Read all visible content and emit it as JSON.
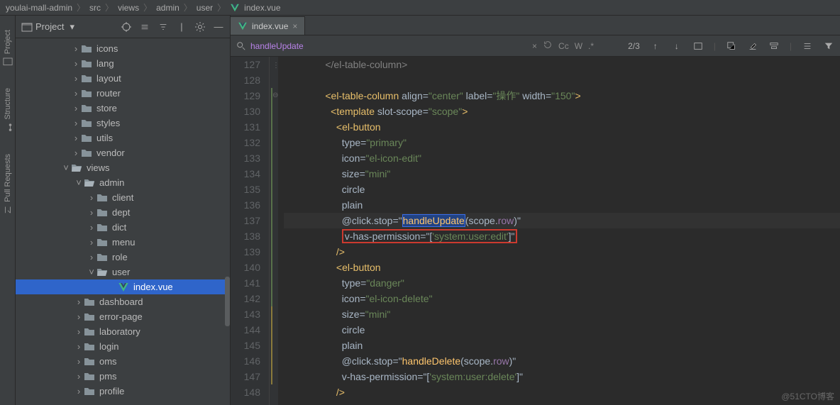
{
  "breadcrumb": [
    "youlai-mall-admin",
    "src",
    "views",
    "admin",
    "user",
    "index.vue"
  ],
  "sidebar": {
    "title": "Project",
    "items": [
      {
        "label": "icons",
        "indent": 78,
        "arrow": ">",
        "kind": "folder"
      },
      {
        "label": "lang",
        "indent": 78,
        "arrow": ">",
        "kind": "folder"
      },
      {
        "label": "layout",
        "indent": 78,
        "arrow": ">",
        "kind": "folder"
      },
      {
        "label": "router",
        "indent": 78,
        "arrow": ">",
        "kind": "folder"
      },
      {
        "label": "store",
        "indent": 78,
        "arrow": ">",
        "kind": "folder"
      },
      {
        "label": "styles",
        "indent": 78,
        "arrow": ">",
        "kind": "folder"
      },
      {
        "label": "utils",
        "indent": 78,
        "arrow": ">",
        "kind": "folder"
      },
      {
        "label": "vendor",
        "indent": 78,
        "arrow": ">",
        "kind": "folder"
      },
      {
        "label": "views",
        "indent": 64,
        "arrow": "v",
        "kind": "folder-open"
      },
      {
        "label": "admin",
        "indent": 82,
        "arrow": "v",
        "kind": "folder-open"
      },
      {
        "label": "client",
        "indent": 100,
        "arrow": ">",
        "kind": "folder"
      },
      {
        "label": "dept",
        "indent": 100,
        "arrow": ">",
        "kind": "folder"
      },
      {
        "label": "dict",
        "indent": 100,
        "arrow": ">",
        "kind": "folder"
      },
      {
        "label": "menu",
        "indent": 100,
        "arrow": ">",
        "kind": "folder"
      },
      {
        "label": "role",
        "indent": 100,
        "arrow": ">",
        "kind": "folder"
      },
      {
        "label": "user",
        "indent": 100,
        "arrow": "v",
        "kind": "folder-open"
      },
      {
        "label": "index.vue",
        "indent": 130,
        "arrow": "",
        "kind": "vue",
        "selected": true
      },
      {
        "label": "dashboard",
        "indent": 82,
        "arrow": ">",
        "kind": "folder"
      },
      {
        "label": "error-page",
        "indent": 82,
        "arrow": ">",
        "kind": "folder"
      },
      {
        "label": "laboratory",
        "indent": 82,
        "arrow": ">",
        "kind": "folder"
      },
      {
        "label": "login",
        "indent": 82,
        "arrow": ">",
        "kind": "folder"
      },
      {
        "label": "oms",
        "indent": 82,
        "arrow": ">",
        "kind": "folder"
      },
      {
        "label": "pms",
        "indent": 82,
        "arrow": ">",
        "kind": "folder"
      },
      {
        "label": "profile",
        "indent": 82,
        "arrow": ">",
        "kind": "folder"
      }
    ]
  },
  "tab": {
    "label": "index.vue"
  },
  "search": {
    "query": "handleUpdate",
    "counter": "2/3",
    "cc": "Cc",
    "w": "W",
    "star": ".*"
  },
  "leftbar": {
    "project": "Project",
    "structure": "Structure",
    "pull": "Pull Requests"
  },
  "lines": [
    127,
    128,
    129,
    130,
    131,
    132,
    133,
    134,
    135,
    136,
    137,
    138,
    139,
    140,
    141,
    142,
    143,
    144,
    145,
    146,
    147,
    148
  ],
  "code": {
    "l127": "</el-table-column>",
    "l129_tag": "el-table-column",
    "l129_attrs": " align=\"center\" label=\"操作\" width=\"150\"",
    "l130_tag": "template",
    "l130_attrs": " slot-scope=\"scope\"",
    "l131": "el-button",
    "l132a": "type=",
    "l132b": "\"primary\"",
    "l133a": "icon=",
    "l133b": "\"el-icon-edit\"",
    "l134a": "size=",
    "l134b": "\"mini\"",
    "l135": "circle",
    "l136": "plain",
    "l137a": "@click.stop=\"",
    "l137fn": "handleUpdate",
    "l137b": "(scope.",
    "l137arg": "row",
    "l137c": ")\"",
    "l138a": "v-has-permission=\"[",
    "l138b": "'system:user:edit'",
    "l138c": "]\"",
    "l139": "/>",
    "l140": "el-button",
    "l141a": "type=",
    "l141b": "\"danger\"",
    "l142a": "icon=",
    "l142b": "\"el-icon-delete\"",
    "l143a": "size=",
    "l143b": "\"mini\"",
    "l144": "circle",
    "l145": "plain",
    "l146a": "@click.stop=\"",
    "l146fn": "handleDelete",
    "l146b": "(scope.",
    "l146arg": "row",
    "l146c": ")\"",
    "l147a": "v-has-permission=\"[",
    "l147b": "'system:user:delete'",
    "l147c": "]\"",
    "l148": "/>"
  },
  "watermark": "@51CTO博客"
}
